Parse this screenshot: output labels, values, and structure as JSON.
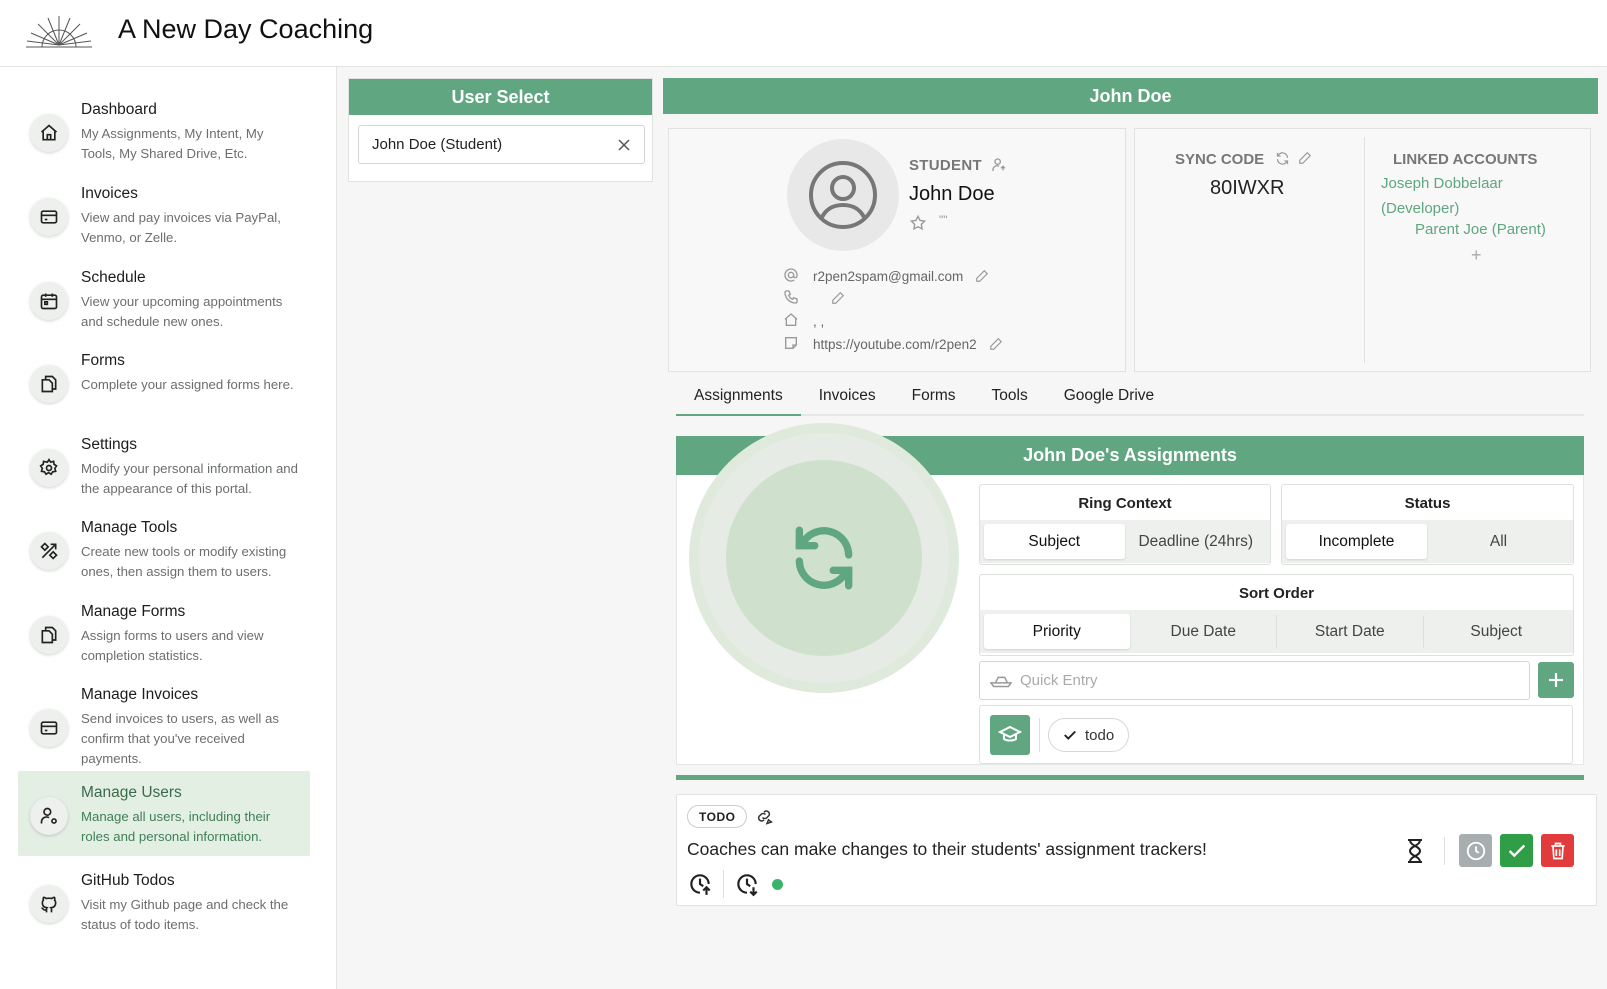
{
  "app": {
    "title": "A New Day Coaching"
  },
  "sidebar": {
    "items": [
      {
        "title": "Dashboard",
        "desc": "My Assignments, My Intent, My Tools, My Shared Drive, Etc.",
        "icon": "home-icon"
      },
      {
        "title": "Invoices",
        "desc": "View and pay invoices via PayPal, Venmo, or Zelle.",
        "icon": "credit-card-icon"
      },
      {
        "title": "Schedule",
        "desc": "View your upcoming appointments and schedule new ones.",
        "icon": "calendar-icon"
      },
      {
        "title": "Forms",
        "desc": "Complete your assigned forms here.",
        "icon": "files-icon"
      },
      {
        "title": "Settings",
        "desc": "Modify your personal information and the appearance of this portal.",
        "icon": "gear-icon"
      },
      {
        "title": "Manage Tools",
        "desc": "Create new tools or modify existing ones, then assign them to users.",
        "icon": "tools-icon"
      },
      {
        "title": "Manage Forms",
        "desc": "Assign forms to users and view completion statistics.",
        "icon": "files-icon"
      },
      {
        "title": "Manage Invoices",
        "desc": "Send invoices to users, as well as confirm that you've received payments.",
        "icon": "credit-card-icon"
      },
      {
        "title": "Manage Users",
        "desc": "Manage all users, including their roles and personal information.",
        "icon": "user-gear-icon",
        "active": true
      },
      {
        "title": "GitHub Todos",
        "desc": "Visit my Github page and check the status of todo items.",
        "icon": "github-icon"
      }
    ]
  },
  "user_select": {
    "header": "User Select",
    "value": "John Doe (Student)"
  },
  "profile": {
    "header": "John Doe",
    "role": "STUDENT",
    "name": "John Doe",
    "quote": "\"\"",
    "email": "r2pen2spam@gmail.com",
    "phone": "",
    "address": ", ,",
    "note": "https://youtube.com/r2pen2"
  },
  "sync": {
    "label": "SYNC CODE",
    "code": "80IWXR",
    "linked_label": "LINKED ACCOUNTS",
    "linked": [
      "Joseph Dobbelaar (Developer)",
      "Parent Joe (Parent)"
    ],
    "add": "+"
  },
  "tabs": [
    "Assignments",
    "Invoices",
    "Forms",
    "Tools",
    "Google Drive"
  ],
  "assignments": {
    "header": "John Doe's Assignments",
    "ring_context": {
      "title": "Ring Context",
      "options": [
        "Subject",
        "Deadline (24hrs)"
      ],
      "selected": "Subject"
    },
    "status": {
      "title": "Status",
      "options": [
        "Incomplete",
        "All"
      ],
      "selected": "Incomplete"
    },
    "sort_order": {
      "title": "Sort Order",
      "options": [
        "Priority",
        "Due Date",
        "Start Date",
        "Subject"
      ],
      "selected": "Priority"
    },
    "quick_entry_placeholder": "Quick Entry",
    "tag": "todo"
  },
  "todo": {
    "badge": "TODO",
    "text": "Coaches can make changes to their students' assignment trackers!"
  },
  "colors": {
    "accent": "#5fa681",
    "accent_light": "#e4efe4",
    "danger": "#e23b3b",
    "success": "#2f9e46",
    "muted": "#a8adb0"
  }
}
